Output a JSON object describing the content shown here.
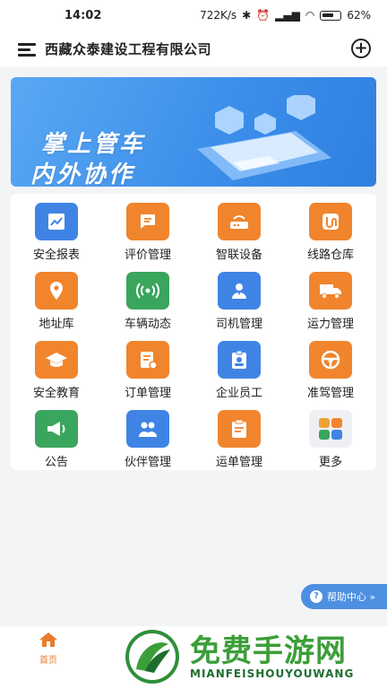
{
  "status_bar": {
    "time": "14:02",
    "network_speed": "722K/s",
    "battery": "62%"
  },
  "header": {
    "title": "西藏众泰建设工程有限公司"
  },
  "banner": {
    "line1": "掌上管车",
    "line2": "内外协作"
  },
  "grid": {
    "items": [
      {
        "label": "安全报表",
        "icon": "report-chart-icon",
        "color": "#3f84e5"
      },
      {
        "label": "评价管理",
        "icon": "comment-icon",
        "color": "#f0852d"
      },
      {
        "label": "智联设备",
        "icon": "device-router-icon",
        "color": "#f0852d"
      },
      {
        "label": "线路仓库",
        "icon": "route-warehouse-icon",
        "color": "#f0852d"
      },
      {
        "label": "地址库",
        "icon": "location-pin-icon",
        "color": "#f0852d"
      },
      {
        "label": "车辆动态",
        "icon": "signal-broadcast-icon",
        "color": "#3aa55d"
      },
      {
        "label": "司机管理",
        "icon": "driver-user-icon",
        "color": "#3f84e5"
      },
      {
        "label": "运力管理",
        "icon": "truck-icon",
        "color": "#f0852d"
      },
      {
        "label": "安全教育",
        "icon": "graduation-cap-icon",
        "color": "#f0852d"
      },
      {
        "label": "订单管理",
        "icon": "order-document-icon",
        "color": "#f0852d"
      },
      {
        "label": "企业员工",
        "icon": "employee-badge-icon",
        "color": "#3f84e5"
      },
      {
        "label": "准驾管理",
        "icon": "steering-wheel-icon",
        "color": "#f0852d"
      },
      {
        "label": "公告",
        "icon": "megaphone-icon",
        "color": "#3aa55d"
      },
      {
        "label": "伙伴管理",
        "icon": "partners-icon",
        "color": "#3f84e5"
      },
      {
        "label": "运单管理",
        "icon": "waybill-clipboard-icon",
        "color": "#f0852d"
      },
      {
        "label": "更多",
        "icon": "more-apps-icon",
        "color": "#eef0f3"
      }
    ]
  },
  "help": {
    "label": "帮助中心 »"
  },
  "bottom_nav": {
    "home_label": "首页"
  },
  "watermark": {
    "text": "免费手游网",
    "sub": "MIANFEISHOUYOUWANG"
  }
}
